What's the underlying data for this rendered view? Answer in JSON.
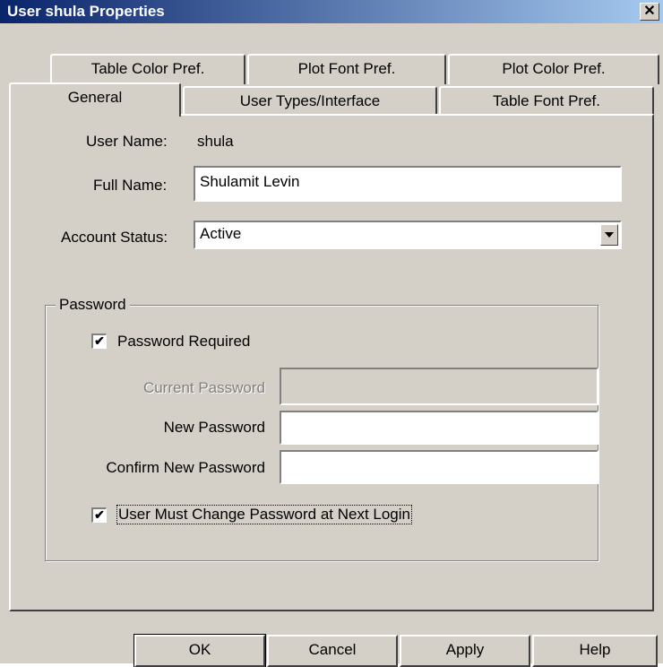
{
  "window": {
    "title": "User shula Properties",
    "close_glyph": "✕"
  },
  "tabs_row_back": [
    "Table Color Pref.",
    "Plot Font Pref.",
    "Plot Color Pref."
  ],
  "tabs_row_front": [
    "General",
    "User Types/Interface",
    "Table Font Pref."
  ],
  "general": {
    "user_name_label": "User Name:",
    "user_name_value": "shula",
    "full_name_label": "Full Name:",
    "full_name_value": "Shulamit Levin",
    "account_status_label": "Account Status:",
    "account_status_value": "Active"
  },
  "password": {
    "group_label": "Password",
    "required_label": "Password Required",
    "required_checked": true,
    "current_label": "Current Password",
    "new_label": "New Password",
    "confirm_label": "Confirm New Password",
    "current_value": "",
    "new_value": "",
    "confirm_value": "",
    "must_change_label": "User Must Change Password at Next Login",
    "must_change_checked": true
  },
  "buttons": {
    "ok": "OK",
    "cancel": "Cancel",
    "apply": "Apply",
    "help": "Help"
  },
  "icons": {
    "check": "✔",
    "dropdown_arrow": "▼"
  }
}
